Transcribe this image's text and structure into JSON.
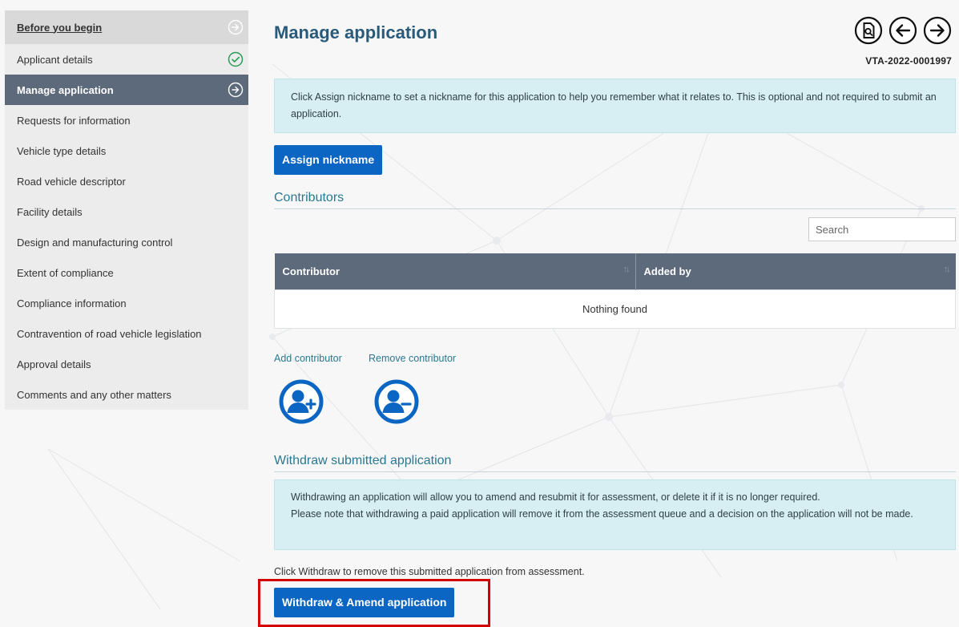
{
  "sidebar": {
    "items": [
      {
        "label": "Before you begin",
        "state": "first",
        "icon": "arrow-right-circle-icon"
      },
      {
        "label": "Applicant details",
        "state": "complete",
        "icon": "check-circle-icon"
      },
      {
        "label": "Manage application",
        "state": "active",
        "icon": "arrow-right-circle-icon"
      },
      {
        "label": "Requests for information"
      },
      {
        "label": "Vehicle type details"
      },
      {
        "label": "Road vehicle descriptor"
      },
      {
        "label": "Facility details"
      },
      {
        "label": "Design and manufacturing control"
      },
      {
        "label": "Extent of compliance"
      },
      {
        "label": "Compliance information"
      },
      {
        "label": "Contravention of road vehicle legislation"
      },
      {
        "label": "Approval details"
      },
      {
        "label": "Comments and any other matters"
      }
    ]
  },
  "header": {
    "title": "Manage application",
    "reference": "VTA-2022-0001997",
    "icons": [
      "document-preview-icon",
      "arrow-left-circle-icon",
      "arrow-right-circle-icon"
    ]
  },
  "nickname": {
    "info": "Click Assign nickname to set a nickname for this application to help you remember what it relates to. This is optional and not required to submit an application.",
    "button": "Assign nickname"
  },
  "contributors": {
    "heading": "Contributors",
    "search_placeholder": "Search",
    "columns": [
      "Contributor",
      "Added by"
    ],
    "empty": "Nothing found",
    "add_label": "Add contributor",
    "remove_label": "Remove contributor"
  },
  "withdraw": {
    "heading": "Withdraw submitted application",
    "info_line1": "Withdrawing an application will allow you to amend and resubmit it for assessment, or delete it if it is no longer required.",
    "info_line2": "Please note that withdrawing a paid application will remove it from the assessment queue and a decision on the application will not be made.",
    "instruction": "Click Withdraw to remove this submitted application from assessment.",
    "button": "Withdraw & Amend application"
  },
  "colors": {
    "accent": "#0b66c3",
    "heading": "#2a5a7a",
    "table_header": "#5d6a7b",
    "info_bg": "#d7eef2",
    "success": "#2e9b57",
    "highlight": "#d40000"
  }
}
